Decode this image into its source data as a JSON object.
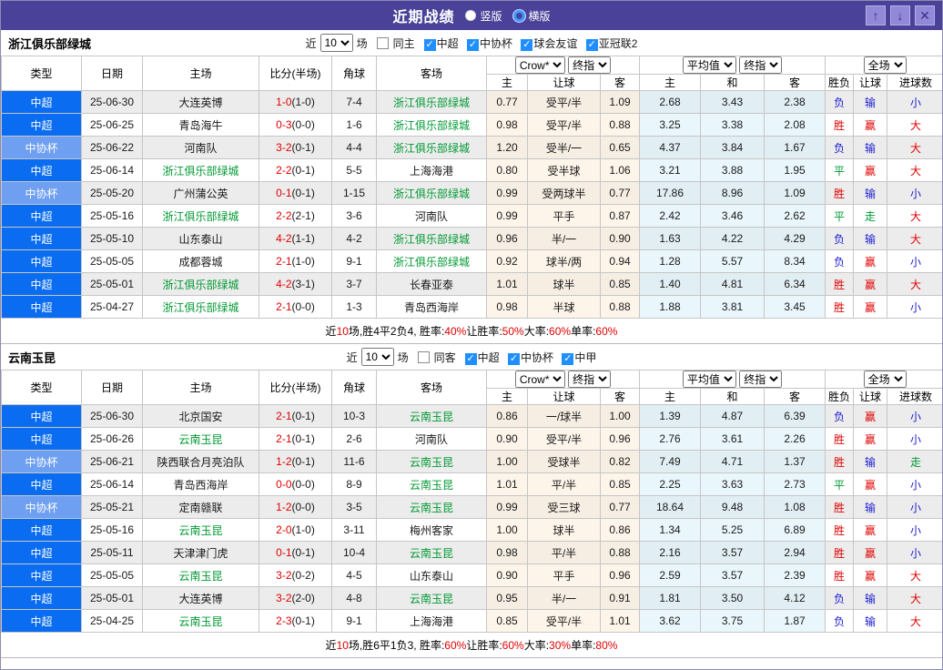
{
  "icons": {
    "check": "✓",
    "up": "↑",
    "down": "↓",
    "close": "✕"
  },
  "header": {
    "title": "近期战绩",
    "view_vertical": "竖版",
    "view_horizontal": "横版"
  },
  "table_header": {
    "cols": [
      "类型",
      "日期",
      "主场",
      "比分(半场)",
      "角球",
      "客场"
    ],
    "g1_select": "Crow*",
    "g1_final": "终指",
    "g2_select": "平均值",
    "g2_final": "终指",
    "g3_select": "全场",
    "sub": [
      "主",
      "让球",
      "客",
      "主",
      "和",
      "客",
      "胜负",
      "让球",
      "进球数"
    ]
  },
  "sections": [
    {
      "team": "浙江俱乐部绿城",
      "filter": {
        "near": "近",
        "count": "10",
        "unit": "场",
        "same": "同主",
        "comps": [
          {
            "label": "中超"
          },
          {
            "label": "中协杯"
          },
          {
            "label": "球会友谊"
          },
          {
            "label": "亚冠联2"
          }
        ]
      },
      "rows": [
        {
          "type": "中超",
          "type_cls": "t-super",
          "date": "25-06-30",
          "home": "大连英博",
          "home_cls": "",
          "score": "1-0",
          "half": "(1-0)",
          "corner": "7-4",
          "away": "浙江俱乐部绿城",
          "away_cls": "focal",
          "h1": "0.77",
          "hd": "受平/半",
          "h2": "1.09",
          "a1": "2.68",
          "a2": "3.43",
          "a3": "2.38",
          "r1": "负",
          "r1c": "c-lose",
          "r2": "输",
          "r2c": "c-lose",
          "r3": "小",
          "r3c": "c-lose"
        },
        {
          "type": "中超",
          "type_cls": "t-super",
          "date": "25-06-25",
          "home": "青岛海牛",
          "home_cls": "",
          "score": "0-3",
          "half": "(0-0)",
          "corner": "1-6",
          "away": "浙江俱乐部绿城",
          "away_cls": "focal",
          "h1": "0.98",
          "hd": "受平/半",
          "h2": "0.88",
          "a1": "3.25",
          "a2": "3.38",
          "a3": "2.08",
          "r1": "胜",
          "r1c": "c-win",
          "r2": "赢",
          "r2c": "c-win",
          "r3": "大",
          "r3c": "c-win"
        },
        {
          "type": "中协杯",
          "type_cls": "t-cup",
          "date": "25-06-22",
          "home": "河南队",
          "home_cls": "",
          "score": "3-2",
          "half": "(0-1)",
          "corner": "4-4",
          "away": "浙江俱乐部绿城",
          "away_cls": "focal",
          "h1": "1.20",
          "hd": "受半/一",
          "h2": "0.65",
          "a1": "4.37",
          "a2": "3.84",
          "a3": "1.67",
          "r1": "负",
          "r1c": "c-lose",
          "r2": "输",
          "r2c": "c-lose",
          "r3": "大",
          "r3c": "c-win"
        },
        {
          "type": "中超",
          "type_cls": "t-super",
          "date": "25-06-14",
          "home": "浙江俱乐部绿城",
          "home_cls": "focal",
          "score": "2-2",
          "half": "(0-1)",
          "corner": "5-5",
          "away": "上海海港",
          "away_cls": "",
          "h1": "0.80",
          "hd": "受半球",
          "h2": "1.06",
          "a1": "3.21",
          "a2": "3.88",
          "a3": "1.95",
          "r1": "平",
          "r1c": "c-draw",
          "r2": "赢",
          "r2c": "c-win",
          "r3": "大",
          "r3c": "c-win"
        },
        {
          "type": "中协杯",
          "type_cls": "t-cup",
          "date": "25-05-20",
          "home": "广州蒲公英",
          "home_cls": "",
          "score": "0-1",
          "half": "(0-1)",
          "corner": "1-15",
          "away": "浙江俱乐部绿城",
          "away_cls": "focal",
          "h1": "0.99",
          "hd": "受两球半",
          "h2": "0.77",
          "a1": "17.86",
          "a2": "8.96",
          "a3": "1.09",
          "r1": "胜",
          "r1c": "c-win",
          "r2": "输",
          "r2c": "c-lose",
          "r3": "小",
          "r3c": "c-lose"
        },
        {
          "type": "中超",
          "type_cls": "t-super",
          "date": "25-05-16",
          "home": "浙江俱乐部绿城",
          "home_cls": "focal",
          "score": "2-2",
          "half": "(2-1)",
          "corner": "3-6",
          "away": "河南队",
          "away_cls": "",
          "h1": "0.99",
          "hd": "平手",
          "h2": "0.87",
          "a1": "2.42",
          "a2": "3.46",
          "a3": "2.62",
          "r1": "平",
          "r1c": "c-draw",
          "r2": "走",
          "r2c": "c-draw",
          "r3": "大",
          "r3c": "c-win"
        },
        {
          "type": "中超",
          "type_cls": "t-super",
          "date": "25-05-10",
          "home": "山东泰山",
          "home_cls": "",
          "score": "4-2",
          "half": "(1-1)",
          "corner": "4-2",
          "away": "浙江俱乐部绿城",
          "away_cls": "focal",
          "h1": "0.96",
          "hd": "半/一",
          "h2": "0.90",
          "a1": "1.63",
          "a2": "4.22",
          "a3": "4.29",
          "r1": "负",
          "r1c": "c-lose",
          "r2": "输",
          "r2c": "c-lose",
          "r3": "大",
          "r3c": "c-win"
        },
        {
          "type": "中超",
          "type_cls": "t-super",
          "date": "25-05-05",
          "home": "成都蓉城",
          "home_cls": "",
          "score": "2-1",
          "half": "(1-0)",
          "corner": "9-1",
          "away": "浙江俱乐部绿城",
          "away_cls": "focal",
          "h1": "0.92",
          "hd": "球半/两",
          "h2": "0.94",
          "a1": "1.28",
          "a2": "5.57",
          "a3": "8.34",
          "r1": "负",
          "r1c": "c-lose",
          "r2": "赢",
          "r2c": "c-win",
          "r3": "小",
          "r3c": "c-lose"
        },
        {
          "type": "中超",
          "type_cls": "t-super",
          "date": "25-05-01",
          "home": "浙江俱乐部绿城",
          "home_cls": "focal",
          "score": "4-2",
          "half": "(3-1)",
          "corner": "3-7",
          "away": "长春亚泰",
          "away_cls": "",
          "h1": "1.01",
          "hd": "球半",
          "h2": "0.85",
          "a1": "1.40",
          "a2": "4.81",
          "a3": "6.34",
          "r1": "胜",
          "r1c": "c-win",
          "r2": "赢",
          "r2c": "c-win",
          "r3": "大",
          "r3c": "c-win"
        },
        {
          "type": "中超",
          "type_cls": "t-super",
          "date": "25-04-27",
          "home": "浙江俱乐部绿城",
          "home_cls": "focal",
          "score": "2-1",
          "half": "(0-0)",
          "corner": "1-3",
          "away": "青岛西海岸",
          "away_cls": "",
          "h1": "0.98",
          "hd": "半球",
          "h2": "0.88",
          "a1": "1.88",
          "a2": "3.81",
          "a3": "3.45",
          "r1": "胜",
          "r1c": "c-win",
          "r2": "赢",
          "r2c": "c-win",
          "r3": "小",
          "r3c": "c-lose"
        }
      ],
      "summary": {
        "p1": "近",
        "n": "10",
        "p2": "场,胜4平2负4, 胜率:",
        "v1": "40%",
        "p3": " 让胜率:",
        "v2": "50%",
        "p4": " 大率:",
        "v3": "60%",
        "p5": " 单率:",
        "v4": "60%"
      }
    },
    {
      "team": "云南玉昆",
      "filter": {
        "near": "近",
        "count": "10",
        "unit": "场",
        "same": "同客",
        "comps": [
          {
            "label": "中超"
          },
          {
            "label": "中协杯"
          },
          {
            "label": "中甲"
          }
        ]
      },
      "rows": [
        {
          "type": "中超",
          "type_cls": "t-super",
          "date": "25-06-30",
          "home": "北京国安",
          "home_cls": "",
          "score": "2-1",
          "half": "(0-1)",
          "corner": "10-3",
          "away": "云南玉昆",
          "away_cls": "focal",
          "h1": "0.86",
          "hd": "一/球半",
          "h2": "1.00",
          "a1": "1.39",
          "a2": "4.87",
          "a3": "6.39",
          "r1": "负",
          "r1c": "c-lose",
          "r2": "赢",
          "r2c": "c-win",
          "r3": "小",
          "r3c": "c-lose"
        },
        {
          "type": "中超",
          "type_cls": "t-super",
          "date": "25-06-26",
          "home": "云南玉昆",
          "home_cls": "focal",
          "score": "2-1",
          "half": "(0-1)",
          "corner": "2-6",
          "away": "河南队",
          "away_cls": "",
          "h1": "0.90",
          "hd": "受平/半",
          "h2": "0.96",
          "a1": "2.76",
          "a2": "3.61",
          "a3": "2.26",
          "r1": "胜",
          "r1c": "c-win",
          "r2": "赢",
          "r2c": "c-win",
          "r3": "小",
          "r3c": "c-lose"
        },
        {
          "type": "中协杯",
          "type_cls": "t-cup",
          "date": "25-06-21",
          "home": "陕西联合月亮泊队",
          "home_cls": "",
          "score": "1-2",
          "half": "(0-1)",
          "corner": "11-6",
          "away": "云南玉昆",
          "away_cls": "focal",
          "h1": "1.00",
          "hd": "受球半",
          "h2": "0.82",
          "a1": "7.49",
          "a2": "4.71",
          "a3": "1.37",
          "r1": "胜",
          "r1c": "c-win",
          "r2": "输",
          "r2c": "c-lose",
          "r3": "走",
          "r3c": "c-draw"
        },
        {
          "type": "中超",
          "type_cls": "t-super",
          "date": "25-06-14",
          "home": "青岛西海岸",
          "home_cls": "",
          "score": "0-0",
          "half": "(0-0)",
          "corner": "8-9",
          "away": "云南玉昆",
          "away_cls": "focal",
          "h1": "1.01",
          "hd": "平/半",
          "h2": "0.85",
          "a1": "2.25",
          "a2": "3.63",
          "a3": "2.73",
          "r1": "平",
          "r1c": "c-draw",
          "r2": "赢",
          "r2c": "c-win",
          "r3": "小",
          "r3c": "c-lose"
        },
        {
          "type": "中协杯",
          "type_cls": "t-cup",
          "date": "25-05-21",
          "home": "定南赣联",
          "home_cls": "",
          "score": "1-2",
          "half": "(0-0)",
          "corner": "3-5",
          "away": "云南玉昆",
          "away_cls": "focal",
          "h1": "0.99",
          "hd": "受三球",
          "h2": "0.77",
          "a1": "18.64",
          "a2": "9.48",
          "a3": "1.08",
          "r1": "胜",
          "r1c": "c-win",
          "r2": "输",
          "r2c": "c-lose",
          "r3": "小",
          "r3c": "c-lose"
        },
        {
          "type": "中超",
          "type_cls": "t-super",
          "date": "25-05-16",
          "home": "云南玉昆",
          "home_cls": "focal",
          "score": "2-0",
          "half": "(1-0)",
          "corner": "3-11",
          "away": "梅州客家",
          "away_cls": "",
          "h1": "1.00",
          "hd": "球半",
          "h2": "0.86",
          "a1": "1.34",
          "a2": "5.25",
          "a3": "6.89",
          "r1": "胜",
          "r1c": "c-win",
          "r2": "赢",
          "r2c": "c-win",
          "r3": "小",
          "r3c": "c-lose"
        },
        {
          "type": "中超",
          "type_cls": "t-super",
          "date": "25-05-11",
          "home": "天津津门虎",
          "home_cls": "",
          "score": "0-1",
          "half": "(0-1)",
          "corner": "10-4",
          "away": "云南玉昆",
          "away_cls": "focal",
          "h1": "0.98",
          "hd": "平/半",
          "h2": "0.88",
          "a1": "2.16",
          "a2": "3.57",
          "a3": "2.94",
          "r1": "胜",
          "r1c": "c-win",
          "r2": "赢",
          "r2c": "c-win",
          "r3": "小",
          "r3c": "c-lose"
        },
        {
          "type": "中超",
          "type_cls": "t-super",
          "date": "25-05-05",
          "home": "云南玉昆",
          "home_cls": "focal",
          "score": "3-2",
          "half": "(0-2)",
          "corner": "4-5",
          "away": "山东泰山",
          "away_cls": "",
          "h1": "0.90",
          "hd": "平手",
          "h2": "0.96",
          "a1": "2.59",
          "a2": "3.57",
          "a3": "2.39",
          "r1": "胜",
          "r1c": "c-win",
          "r2": "赢",
          "r2c": "c-win",
          "r3": "大",
          "r3c": "c-win"
        },
        {
          "type": "中超",
          "type_cls": "t-super",
          "date": "25-05-01",
          "home": "大连英博",
          "home_cls": "",
          "score": "3-2",
          "half": "(2-0)",
          "corner": "4-8",
          "away": "云南玉昆",
          "away_cls": "focal",
          "h1": "0.95",
          "hd": "半/一",
          "h2": "0.91",
          "a1": "1.81",
          "a2": "3.50",
          "a3": "4.12",
          "r1": "负",
          "r1c": "c-lose",
          "r2": "输",
          "r2c": "c-lose",
          "r3": "大",
          "r3c": "c-win"
        },
        {
          "type": "中超",
          "type_cls": "t-super",
          "date": "25-04-25",
          "home": "云南玉昆",
          "home_cls": "focal",
          "score": "2-3",
          "half": "(0-1)",
          "corner": "9-1",
          "away": "上海海港",
          "away_cls": "",
          "h1": "0.85",
          "hd": "受平/半",
          "h2": "1.01",
          "a1": "3.62",
          "a2": "3.75",
          "a3": "1.87",
          "r1": "负",
          "r1c": "c-lose",
          "r2": "输",
          "r2c": "c-lose",
          "r3": "大",
          "r3c": "c-win"
        }
      ],
      "summary": {
        "p1": "近",
        "n": "10",
        "p2": "场,胜6平1负3, 胜率:",
        "v1": "60%",
        "p3": " 让胜率:",
        "v2": "60%",
        "p4": " 大率:",
        "v3": "30%",
        "p5": " 单率:",
        "v4": "80%"
      }
    }
  ]
}
